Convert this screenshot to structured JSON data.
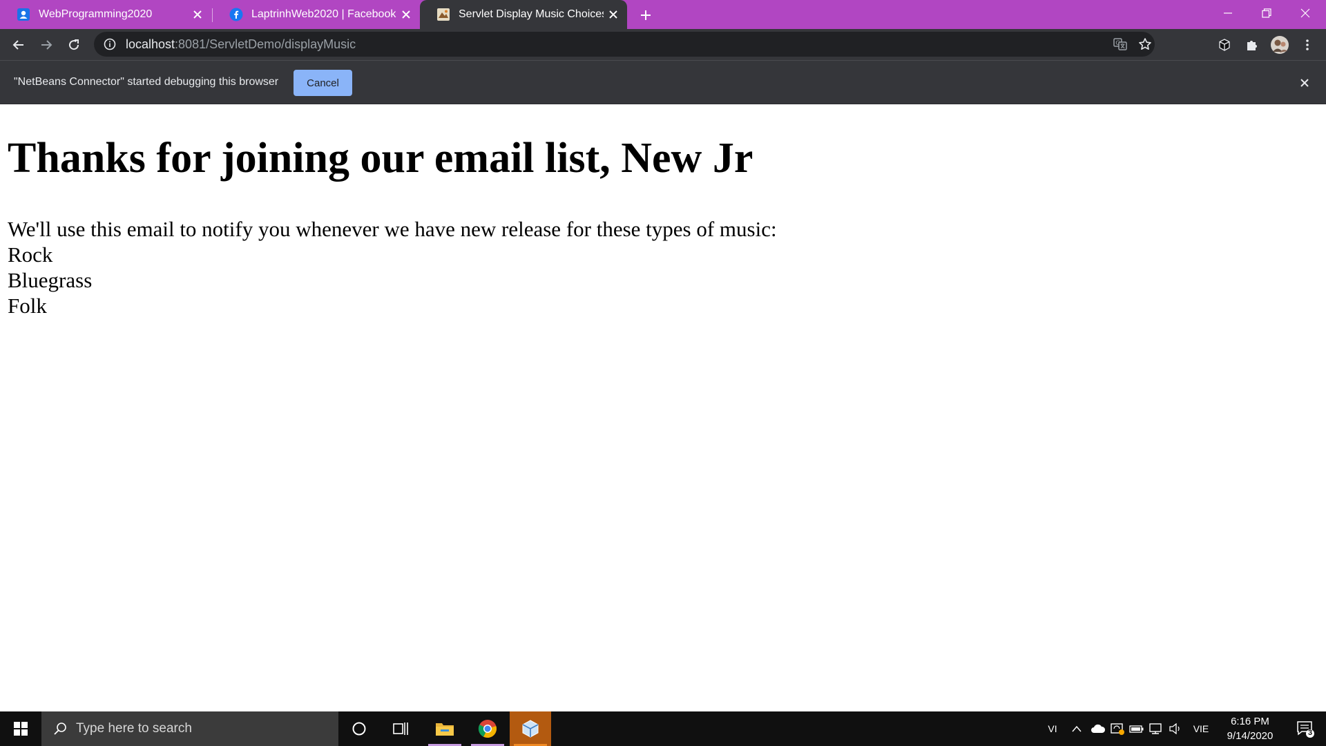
{
  "browser": {
    "tabs": [
      {
        "title": "WebProgramming2020",
        "favicon": "people-icon",
        "active": false
      },
      {
        "title": "LaptrinhWeb2020 | Facebook",
        "favicon": "facebook-icon",
        "active": false
      },
      {
        "title": "Servlet Display Music Choices Ser",
        "favicon": "page-icon",
        "active": true
      }
    ],
    "address": {
      "host": "localhost",
      "rest": ":8081/ServletDemo/displayMusic"
    },
    "infobar": {
      "message": "\"NetBeans Connector\" started debugging this browser",
      "cancel_label": "Cancel"
    },
    "colors": {
      "tabstrip": "#b146c2",
      "toolbar": "#35363a",
      "cancel_button": "#8ab4f8"
    }
  },
  "page": {
    "heading": "Thanks for joining our email list, New Jr",
    "intro": "We'll use this email to notify you whenever we have new release for these types of music:",
    "music_types": [
      "Rock",
      "Bluegrass",
      "Folk"
    ]
  },
  "taskbar": {
    "search_placeholder": "Type here to search",
    "ime": "VI",
    "language": "VIE",
    "time": "6:16 PM",
    "date": "9/14/2020",
    "notification_count": "3"
  }
}
